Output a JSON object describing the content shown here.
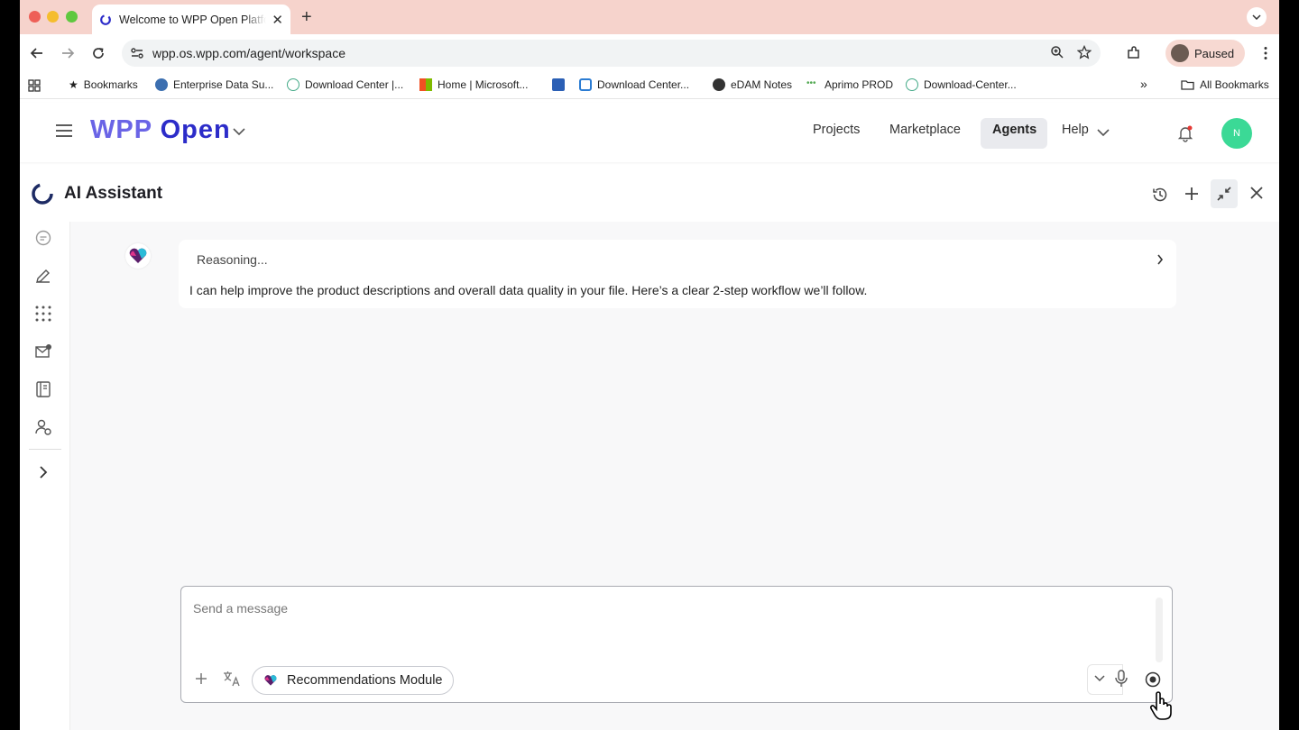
{
  "browser": {
    "tab_title": "Welcome to WPP Open Platform",
    "url": "wpp.os.wpp.com/agent/workspace",
    "profile_label": "Paused",
    "bookmarks": [
      {
        "label": "Bookmarks"
      },
      {
        "label": "Enterprise Data Su..."
      },
      {
        "label": "Download Center |..."
      },
      {
        "label": "Home | Microsoft..."
      },
      {
        "label": ""
      },
      {
        "label": "Download Center..."
      },
      {
        "label": "eDAM Notes"
      },
      {
        "label": "Aprimo PROD"
      },
      {
        "label": "Download-Center..."
      }
    ],
    "all_bookmarks_label": "All Bookmarks"
  },
  "app": {
    "logo_prefix": "WPP",
    "logo_suffix": "Open",
    "nav": [
      "Projects",
      "Marketplace",
      "Agents",
      "Help"
    ],
    "active_nav": "Agents",
    "user_initial": "N"
  },
  "assistant": {
    "title": "AI Assistant",
    "reasoning_label": "Reasoning...",
    "message": "I can help improve the product descriptions and overall data quality in your file. Here’s a clear 2-step workflow we’ll follow.",
    "composer_placeholder": "Send a message",
    "module_label": "Recommendations Module"
  },
  "colors": {
    "tab_strip": "#f6d3cc",
    "logo_blue": "#2c2cc9",
    "avatar_green": "#3bd996"
  }
}
